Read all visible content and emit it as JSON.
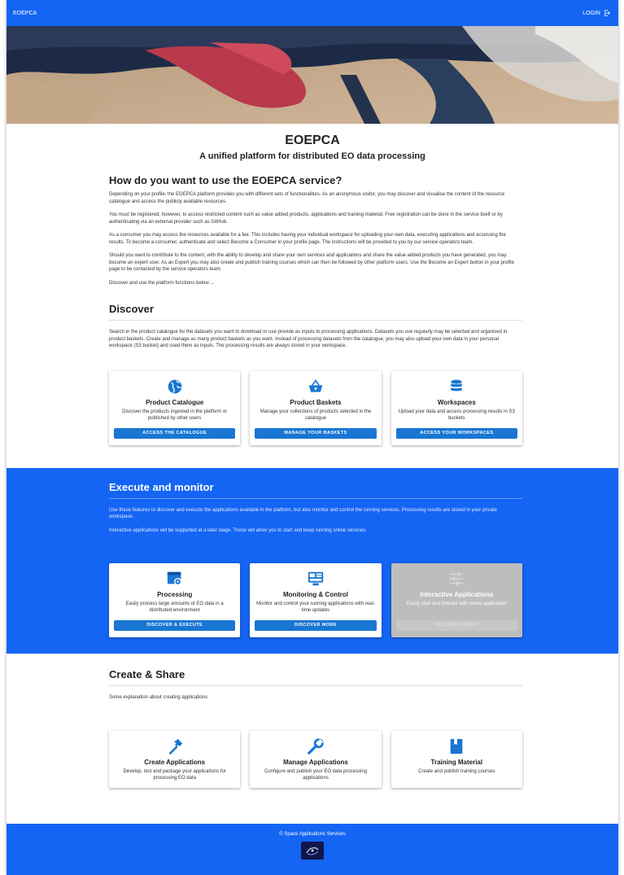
{
  "topbar": {
    "brand": "EOEPCA",
    "login_label": "LOGIN"
  },
  "header": {
    "title": "EOEPCA",
    "subtitle": "A unified platform for distributed EO data processing"
  },
  "intro": {
    "heading": "How do you want to use the EOEPCA service?",
    "paragraphs": [
      "Depending on your profile, the EOEPCA platform provides you with different sets of functionalities. As an anonymous visitor, you may discover and visualise the content of the resource catalogue and access the publicly available resources.",
      "You must be registered, however, to access restricted content such as value added products, applications and training material. Free registration can be done in the service itself or by authenticating via an external provider such as GitHub.",
      "As a consumer you may access the resources available for a fee. This includes having your individual workspace for uploading your own data, executing applications and accessing the results. To become a consumer, authenticate and select Become a Consumer in your profile page. The instructions will be provided to you by our service operators team.",
      "Should you want to contribute to the content, with the ability to develop and share your own services and applications and share the value added products you have generated, you may become an expert user. As an Expert you may also create and publish training courses which can then be followed by other platform users. Use the Become an Expert button in your profile page to be contacted by the service operators team.",
      "Discover and use the platform functions below ..."
    ]
  },
  "discover": {
    "heading": "Discover",
    "text": "Search in the product catalogue for the datasets you want to download or use provide as inputs to processing applications. Datasets you use regularly may be selected and organised in product baskets. Create and manage as many product baskets as you want. Instead of processing datasets from the catalogue, you may also upload your own data in your personal workspace (S3 bucket) and used them as inputs. The processing results are always stored in your workspace.",
    "cards": [
      {
        "icon": "globe-icon",
        "title": "Product Catalogue",
        "desc": "Discover the products ingested in the platform or published by other users",
        "button": "ACCESS THE CATALOGUE"
      },
      {
        "icon": "basket-icon",
        "title": "Product Baskets",
        "desc": "Manage your collections of products selected in the catalogue",
        "button": "MANAGE YOUR BASKETS"
      },
      {
        "icon": "database-icon",
        "title": "Workspaces",
        "desc": "Upload your data and access processing results in S3 buckets",
        "button": "ACCESS YOUR WORKSPACES"
      }
    ]
  },
  "execute": {
    "heading": "Execute and monitor",
    "paragraphs": [
      "Use these features to discover and execute the applications available in the platform, but also monitor and control the running services. Processing results are stored in your private workspace.",
      "Interactive applications will be supported at a later stage. These will allow you to start and keep running online services."
    ],
    "cards": [
      {
        "icon": "settings-window-icon",
        "title": "Processing",
        "desc": "Easily process large amounts of EO data in a distributed environment",
        "button": "DISCOVER & EXECUTE"
      },
      {
        "icon": "monitor-dashboard-icon",
        "title": "Monitoring & Control",
        "desc": "Monitor and control your running applications with real-time updates",
        "button": "DISCOVER MORE"
      },
      {
        "icon": "sliders-icon",
        "title": "Interactive Applications",
        "desc": "Easily start and interact with online application",
        "button": "DISCOVER MORE"
      }
    ]
  },
  "create": {
    "heading": "Create & Share",
    "text": "Some explanation about creating applications",
    "cards": [
      {
        "icon": "hammer-icon",
        "title": "Create Applications",
        "desc": "Develop, test and package your applications for processing EO data"
      },
      {
        "icon": "wrench-icon",
        "title": "Manage Applications",
        "desc": "Configure and publish your EO data processing applications"
      },
      {
        "icon": "book-icon",
        "title": "Training Material",
        "desc": "Create and publish training courses"
      }
    ]
  },
  "footer": {
    "copyright": "© Space Applications Services"
  },
  "colors": {
    "primary": "#1565f4",
    "button": "#1976d2",
    "disabled": "#bdbdbd"
  }
}
